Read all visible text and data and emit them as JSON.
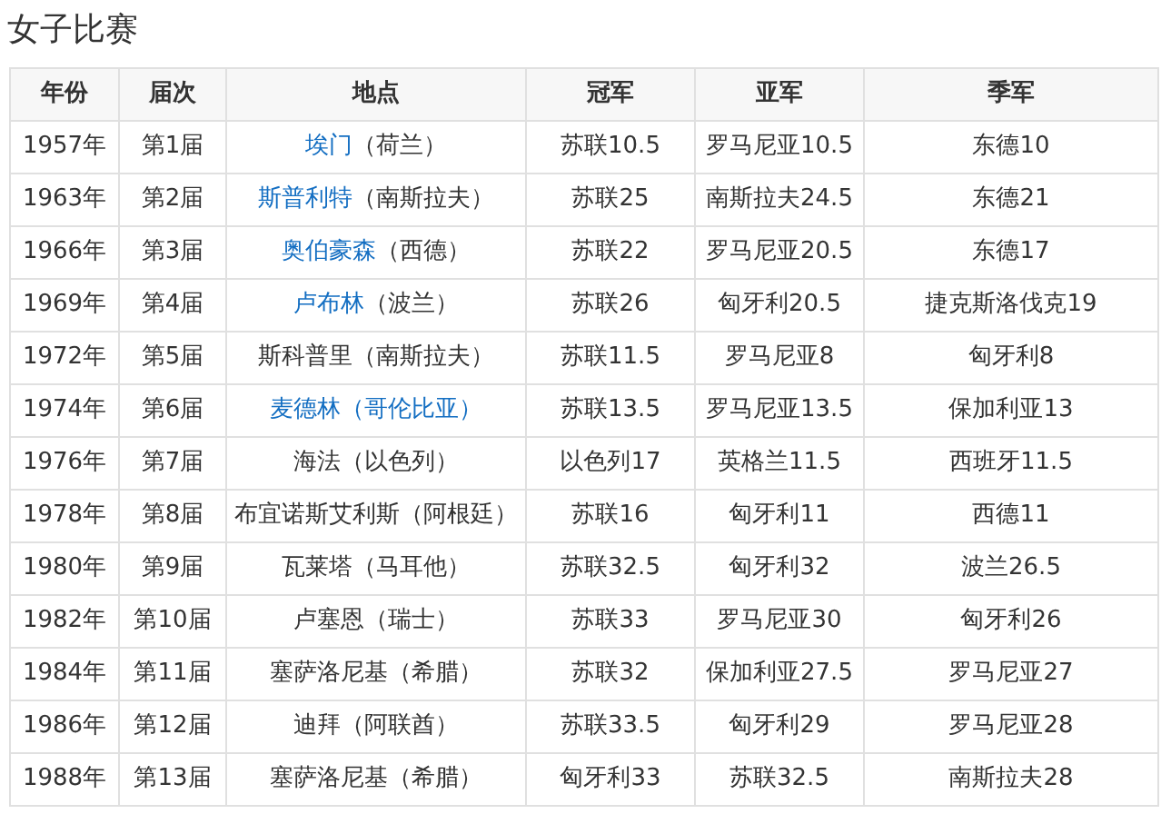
{
  "title": "女子比赛",
  "table": {
    "columns": [
      "年份",
      "届次",
      "地点",
      "冠军",
      "亚军",
      "季军"
    ],
    "rows": [
      {
        "year": "1957年",
        "edition": "第1届",
        "city": "埃门",
        "country": "（荷兰）",
        "city_link": true,
        "country_link": false,
        "gold": "苏联10.5",
        "silver": "罗马尼亚10.5",
        "bronze": "东德10"
      },
      {
        "year": "1963年",
        "edition": "第2届",
        "city": "斯普利特",
        "country": "（南斯拉夫）",
        "city_link": true,
        "country_link": false,
        "gold": "苏联25",
        "silver": "南斯拉夫24.5",
        "bronze": "东德21"
      },
      {
        "year": "1966年",
        "edition": "第3届",
        "city": "奥伯豪森",
        "country": "（西德）",
        "city_link": true,
        "country_link": false,
        "gold": "苏联22",
        "silver": "罗马尼亚20.5",
        "bronze": "东德17"
      },
      {
        "year": "1969年",
        "edition": "第4届",
        "city": "卢布林",
        "country": "（波兰）",
        "city_link": true,
        "country_link": false,
        "gold": "苏联26",
        "silver": "匈牙利20.5",
        "bronze": "捷克斯洛伐克19"
      },
      {
        "year": "1972年",
        "edition": "第5届",
        "city": "斯科普里",
        "country": "（南斯拉夫）",
        "city_link": false,
        "country_link": false,
        "gold": "苏联11.5",
        "silver": "罗马尼亚8",
        "bronze": "匈牙利8"
      },
      {
        "year": "1974年",
        "edition": "第6届",
        "city": "麦德林",
        "country": "（哥伦比亚）",
        "city_link": true,
        "country_link": true,
        "gold": "苏联13.5",
        "silver": "罗马尼亚13.5",
        "bronze": "保加利亚13"
      },
      {
        "year": "1976年",
        "edition": "第7届",
        "city": "海法",
        "country": "（以色列）",
        "city_link": false,
        "country_link": false,
        "gold": "以色列17",
        "silver": "英格兰11.5",
        "bronze": "西班牙11.5"
      },
      {
        "year": "1978年",
        "edition": "第8届",
        "city": "布宜诺斯艾利斯",
        "country": "（阿根廷）",
        "city_link": false,
        "country_link": false,
        "gold": "苏联16",
        "silver": "匈牙利11",
        "bronze": "西德11"
      },
      {
        "year": "1980年",
        "edition": "第9届",
        "city": "瓦莱塔",
        "country": "（马耳他）",
        "city_link": false,
        "country_link": false,
        "gold": "苏联32.5",
        "silver": "匈牙利32",
        "bronze": "波兰26.5"
      },
      {
        "year": "1982年",
        "edition": "第10届",
        "city": "卢塞恩",
        "country": "（瑞士）",
        "city_link": false,
        "country_link": false,
        "gold": "苏联33",
        "silver": "罗马尼亚30",
        "bronze": "匈牙利26"
      },
      {
        "year": "1984年",
        "edition": "第11届",
        "city": "塞萨洛尼基",
        "country": "（希腊）",
        "city_link": false,
        "country_link": false,
        "gold": "苏联32",
        "silver": "保加利亚27.5",
        "bronze": "罗马尼亚27"
      },
      {
        "year": "1986年",
        "edition": "第12届",
        "city": "迪拜",
        "country": "（阿联酋）",
        "city_link": false,
        "country_link": false,
        "gold": "苏联33.5",
        "silver": "匈牙利29",
        "bronze": "罗马尼亚28"
      },
      {
        "year": "1988年",
        "edition": "第13届",
        "city": "塞萨洛尼基",
        "country": "（希腊）",
        "city_link": false,
        "country_link": false,
        "gold": "匈牙利33",
        "silver": "苏联32.5",
        "bronze": "南斯拉夫28"
      }
    ]
  }
}
